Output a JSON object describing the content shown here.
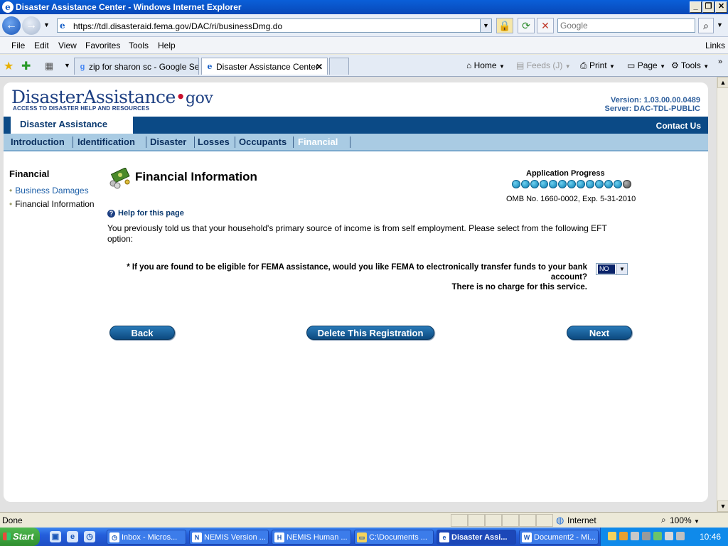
{
  "window": {
    "title": "Disaster Assistance Center - Windows Internet Explorer"
  },
  "address_bar": {
    "url": "https://tdl.disasteraid.fema.gov/DAC/ri/businessDmg.do",
    "search_placeholder": "Google"
  },
  "menu": {
    "items": [
      "File",
      "Edit",
      "View",
      "Favorites",
      "Tools",
      "Help"
    ],
    "links_label": "Links"
  },
  "tabs": {
    "items": [
      {
        "label": "zip for sharon sc - Google Se..."
      },
      {
        "label": "Disaster Assistance Center"
      }
    ],
    "close_glyph": "✕"
  },
  "toolbar": {
    "home": "Home",
    "feeds": "Feeds (J)",
    "print": "Print",
    "page": "Page",
    "tools": "Tools"
  },
  "site": {
    "logo_word": "DisasterAssistance",
    "logo_dot": "•",
    "logo_gov": "gov",
    "tagline": "ACCESS TO DISASTER HELP AND RESOURCES",
    "version": "Version: 1.03.00.00.0489",
    "server": "Server: DAC-TDL-PUBLIC",
    "section_label": "Disaster Assistance",
    "contact_us": "Contact Us"
  },
  "nav_tabs": [
    {
      "label": "Introduction"
    },
    {
      "label": "Identification"
    },
    {
      "label": "Disaster"
    },
    {
      "label": "Losses"
    },
    {
      "label": "Occupants"
    },
    {
      "label": "Financial"
    }
  ],
  "sidebar": {
    "heading": "Financial",
    "items": [
      {
        "label": "Business Damages"
      },
      {
        "label": "Financial Information"
      }
    ]
  },
  "main": {
    "title": "Financial Information",
    "progress_label": "Application Progress",
    "progress": {
      "completed": 12,
      "total": 13
    },
    "omb": "OMB No. 1660-0002, Exp. 5-31-2010",
    "help_link": "Help for this page",
    "intro": "You previously told us that your household's primary source of income is from self employment. Please select from the following EFT option:",
    "question": "* If you are found to be eligible for FEMA assistance, would you like FEMA to electronically transfer funds to your bank account?",
    "note": "There is no charge for this service.",
    "eft_value": "NO",
    "buttons": {
      "back": "Back",
      "delete": "Delete This Registration",
      "next": "Next"
    }
  },
  "status_bar": {
    "text": "Done",
    "zone": "Internet",
    "zoom": "100%"
  },
  "taskbar": {
    "start": "Start",
    "tasks": [
      {
        "label": "Inbox - Micros..."
      },
      {
        "label": "NEMIS Version ..."
      },
      {
        "label": "NEMIS Human ..."
      },
      {
        "label": "C:\\Documents ..."
      },
      {
        "label": "Disaster Assi..."
      },
      {
        "label": "Document2 - Mi..."
      }
    ],
    "clock": "10:46"
  }
}
